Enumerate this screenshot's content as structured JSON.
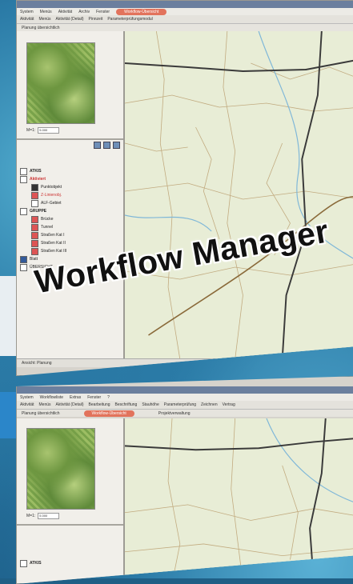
{
  "caption": "Workflow Manager",
  "top_window": {
    "menu": [
      "System",
      "Menüs",
      "Aktivität",
      "Archiv",
      "Fenster"
    ],
    "toolbar": [
      "Aktivität",
      "Menüs",
      "Aktivität (Detail)",
      "Pinnzeit",
      "Parameterprüfungsmodul"
    ],
    "workflow_button": "Workflow-Übersicht",
    "subtoolbar": "Planung übersichtlich",
    "zoom_label": "M=1:",
    "zoom_value": "5.000",
    "layer_header": "ATKIS",
    "tree": [
      {
        "label": "ATKIS",
        "kind": "hdr",
        "color": "plain"
      },
      {
        "label": "Aktiviert",
        "kind": "red",
        "color": "red"
      },
      {
        "label": "Punktobjekt",
        "kind": "item",
        "color": "plain"
      },
      {
        "label": "Z-Linienobj.",
        "kind": "item",
        "color": "red"
      },
      {
        "label": "ALF-Gebiet",
        "kind": "item",
        "color": "plain"
      },
      {
        "label": "GRUPPE",
        "kind": "hdr",
        "color": "plain"
      },
      {
        "label": "Brücke",
        "kind": "item",
        "color": "plain"
      },
      {
        "label": "Tunnel",
        "kind": "item",
        "color": "plain"
      },
      {
        "label": "Straßen Kat I",
        "kind": "item",
        "color": "plain"
      },
      {
        "label": "Straßen Kat II",
        "kind": "item",
        "color": "plain"
      },
      {
        "label": "Straßen Kat III",
        "kind": "item",
        "color": "plain"
      },
      {
        "label": "Blatt",
        "kind": "item",
        "color": "blue"
      },
      {
        "label": "ÜBERSICHT",
        "kind": "item",
        "color": "plain"
      }
    ],
    "status": "Ansicht: Planung"
  },
  "bottom_window": {
    "menu": [
      "System",
      "Workflowliste",
      "Extras",
      "Fenster",
      "?"
    ],
    "toolbar": [
      "Aktivität",
      "Menüs",
      "Aktivität (Detail)",
      "Bearbeitung",
      "Beschriftung",
      "Stauhöhe",
      "Parameterprüfung",
      "Zeichnen",
      "Vertrag"
    ],
    "workflow_button": "Workflow-Übersicht",
    "extra": "Projektverwaltung",
    "subtoolbar": "Planung übersichtlich",
    "zoom_label": "M=1:",
    "zoom_value": "5.000",
    "layer_header": "ATKIS"
  },
  "colors": {
    "accent": "#e2735c",
    "road": "#3a3a3a",
    "minor_road": "#b89a6a",
    "water": "#7fb7d8",
    "map_bg": "#e8edd6"
  }
}
